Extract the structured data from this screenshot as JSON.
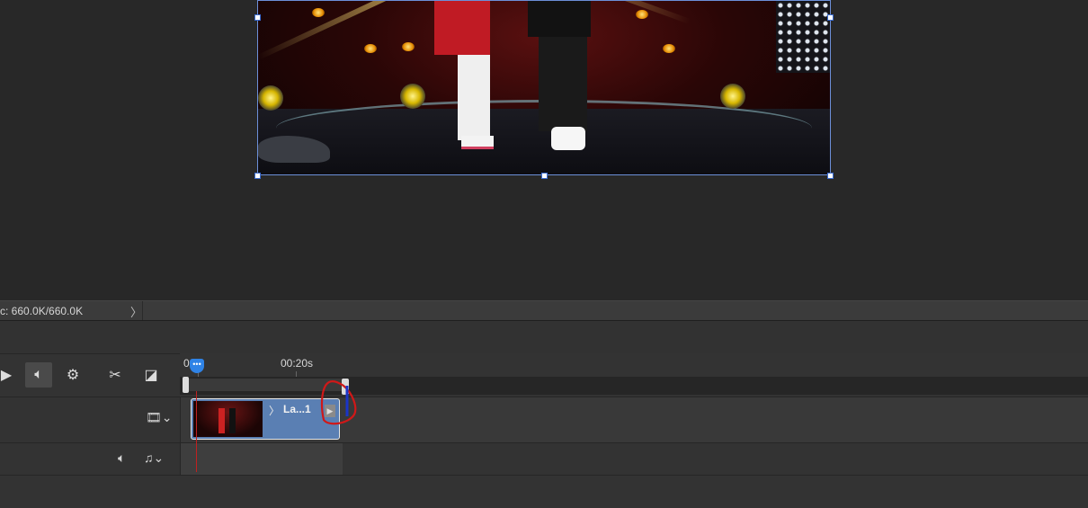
{
  "status_bar": {
    "doc_info": "c: 660.0K/660.0K",
    "expand_arrow": "〉"
  },
  "timeline": {
    "ruler": {
      "start_label": "0",
      "mark_label": "00:20s"
    },
    "toolbar": {
      "play_icon": "play-icon",
      "audio_icon": "speaker-icon",
      "settings_icon": "gear-icon",
      "split_icon": "scissors-icon",
      "transition_icon": "transition-icon"
    },
    "video_track": {
      "clip_label": "La...1",
      "chevron": "〉",
      "menu_icon": "film-strip-icon"
    },
    "audio_track": {
      "mute_icon": "speaker-icon",
      "menu_icon": "music-note-icon"
    },
    "playhead_glyph": "•••"
  },
  "colors": {
    "accent": "#2f83e6",
    "clip": "#5a7fb3",
    "playhead_line": "#c02020",
    "annotation_red": "#d01818",
    "annotation_blue": "#1a35c8"
  }
}
